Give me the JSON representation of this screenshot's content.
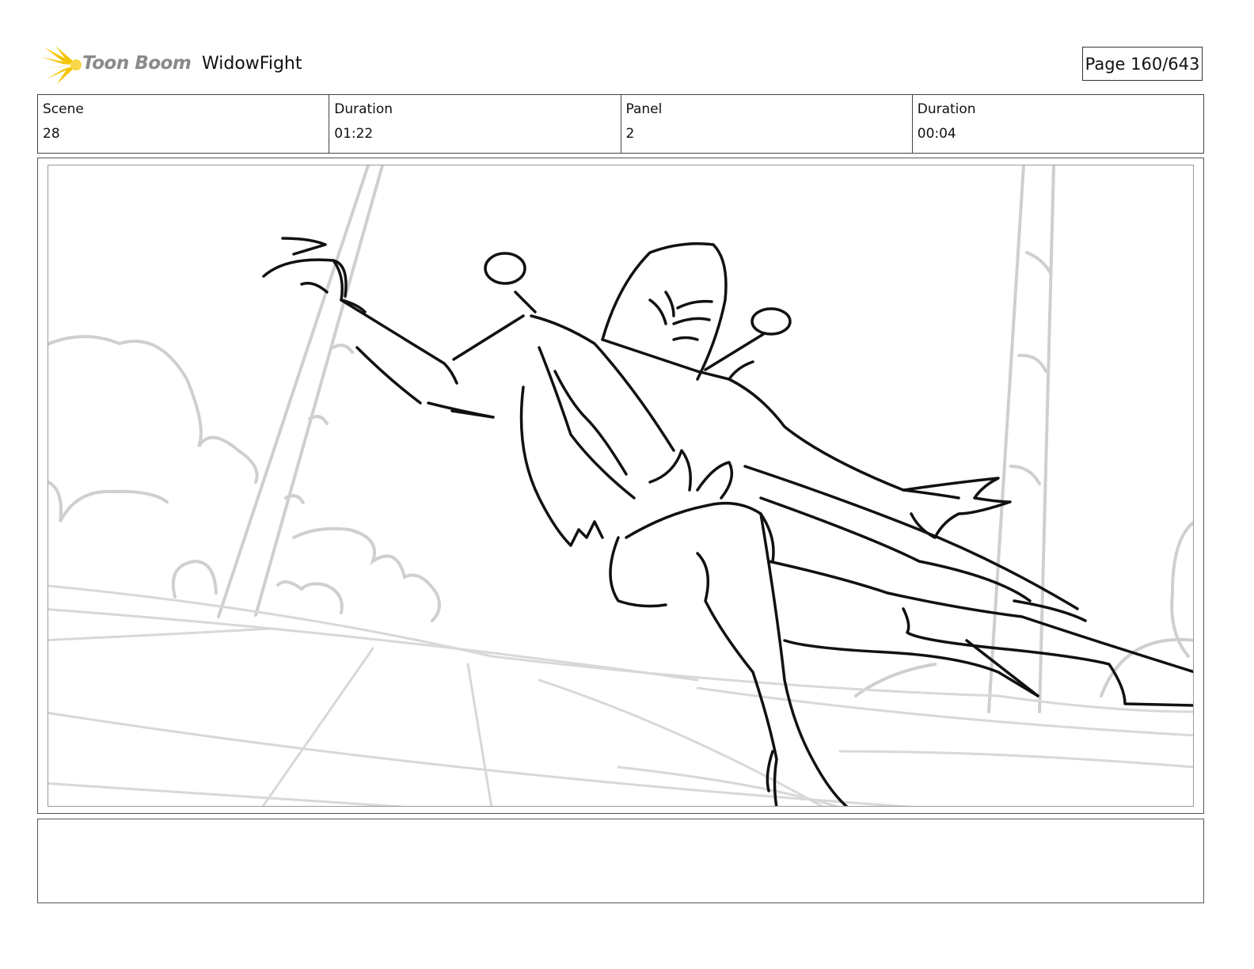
{
  "header": {
    "brand": "Toon Boom",
    "project_title": "WidowFight",
    "page_indicator": "Page 160/643"
  },
  "info": {
    "scene_label": "Scene",
    "scene_value": "28",
    "scene_duration_label": "Duration",
    "scene_duration_value": "01:22",
    "panel_label": "Panel",
    "panel_value": "2",
    "panel_duration_label": "Duration",
    "panel_duration_value": "00:04"
  },
  "colors": {
    "brand_yellow": "#f5c400",
    "sketch_ink": "#111111",
    "background_sketch": "#c8c8c8"
  }
}
